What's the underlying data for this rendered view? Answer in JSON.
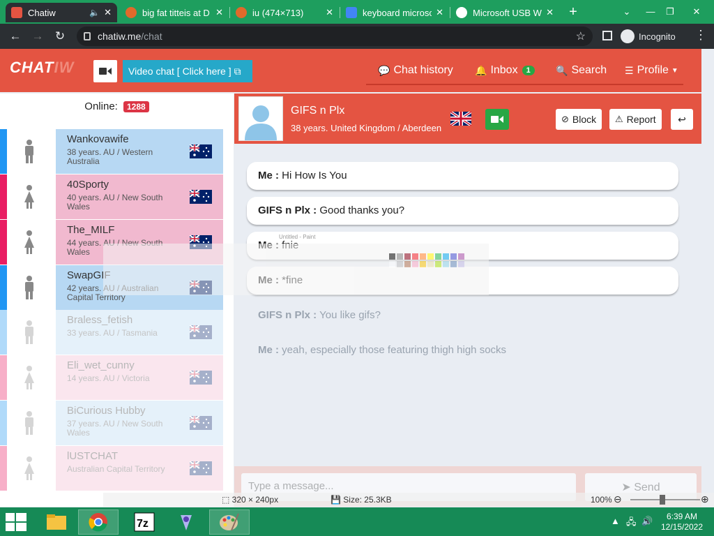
{
  "browser": {
    "tabs": [
      {
        "title": "Chatiw",
        "favicon_color": "#e45442",
        "active": true
      },
      {
        "title": "big fat titteis at D",
        "favicon_color": "#e06a2b",
        "active": false
      },
      {
        "title": "iu (474×713)",
        "favicon_color": "#e06a2b",
        "active": false
      },
      {
        "title": "keyboard microsc",
        "favicon_color": "#4285f4",
        "active": false
      },
      {
        "title": "Microsoft USB W",
        "favicon_color": "#1e9e5e",
        "active": false
      }
    ],
    "new_tab_icon": "+",
    "window_controls": [
      "⌄",
      "—",
      "❐",
      "✕"
    ],
    "url_host": "chatiw.me",
    "url_path": "/chat",
    "incognito_label": "Incognito"
  },
  "site": {
    "logo_a": "CHAT",
    "logo_b": "IW",
    "video_chat_label": "Video chat  [ Click here ]",
    "nav": {
      "chat_history": "Chat history",
      "inbox": "Inbox",
      "inbox_count": "1",
      "search": "Search",
      "profile": "Profile"
    },
    "online_label": "Online:",
    "online_count": "1288"
  },
  "users": [
    {
      "name": "Wankovawife",
      "info": "38 years. AU / Western Australia",
      "gender": "male",
      "card_color": "#b7d8f3",
      "stripe": "#2196f3",
      "flag": "au"
    },
    {
      "name": "40Sporty",
      "info": "40 years. AU / New South Wales",
      "gender": "female",
      "card_color": "#f1b9cf",
      "stripe": "#e91e63",
      "flag": "au"
    },
    {
      "name": "The_MILF",
      "info": "44 years. AU / New South Wales",
      "gender": "female",
      "card_color": "#f1b9cf",
      "stripe": "#e91e63",
      "flag": "au"
    },
    {
      "name": "SwapGIF",
      "info": "42 years. AU / Australian Capital Territory",
      "gender": "male",
      "card_color": "#b7d8f3",
      "stripe": "#2196f3",
      "flag": "au"
    },
    {
      "name": "Braless_fetish",
      "info": "33 years. AU / Tasmania",
      "gender": "male",
      "card_color": "#b7d8f3",
      "stripe": "#2196f3",
      "flag": "au"
    },
    {
      "name": "Eli_wet_cunny",
      "info": "14 years. AU / Victoria",
      "gender": "female",
      "card_color": "#f1b9cf",
      "stripe": "#e91e63",
      "flag": "au"
    },
    {
      "name": "BiCurious Hubby",
      "info": "37 years. AU / New South Wales",
      "gender": "male",
      "card_color": "#b7d8f3",
      "stripe": "#2196f3",
      "flag": "au"
    },
    {
      "name": "lUSTCHAT",
      "info": "Australian Capital Territory",
      "gender": "female",
      "card_color": "#f1b9cf",
      "stripe": "#e91e63",
      "flag": "au"
    }
  ],
  "chat": {
    "partner_name": "GIFS n Plx",
    "partner_info": "38 years. United Kingdom / Aberdeen",
    "block_label": "Block",
    "report_label": "Report",
    "messages": [
      {
        "sender": "Me :",
        "text": "Hi How Is You",
        "ghost": false
      },
      {
        "sender": "GIFS n Plx :",
        "text": "Good thanks you?",
        "ghost": false
      },
      {
        "sender": "Me :",
        "text": "fnie",
        "ghost": false
      },
      {
        "sender": "Me :",
        "text": "*fine",
        "ghost": false
      },
      {
        "sender": "GIFS n Plx :",
        "text": "You like gifs?",
        "ghost": true
      },
      {
        "sender": "Me :",
        "text": "yeah, especially those featuring thigh high socks",
        "ghost": true
      }
    ],
    "input_placeholder": "Type a message...",
    "send_label": "Send"
  },
  "paint": {
    "title": "Untitled - Paint",
    "dimensions": "320 × 240px",
    "size": "Size: 25.3KB",
    "zoom": "100%"
  },
  "taskbar": {
    "time": "6:39 AM",
    "date": "12/15/2022"
  },
  "colors": {
    "brand": "#e45442",
    "tab_strip": "#1e9e5e",
    "taskbar": "#168a56",
    "video_btn": "#26a8c9"
  }
}
